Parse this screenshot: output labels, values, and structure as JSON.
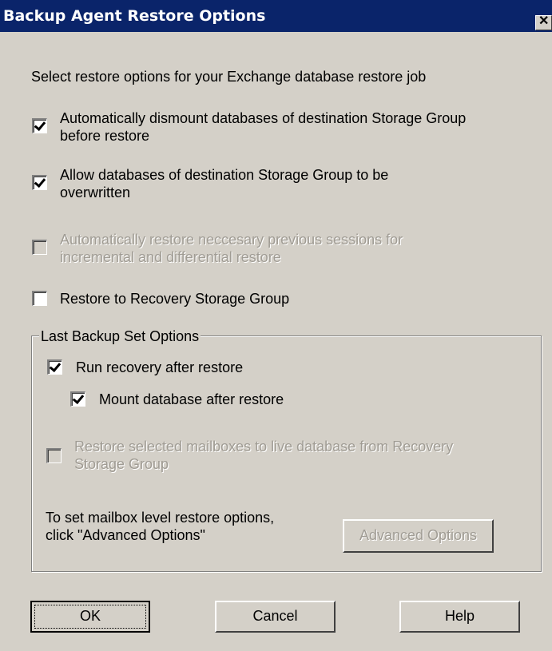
{
  "window": {
    "title": "Backup Agent Restore Options",
    "close_glyph": "✕"
  },
  "prompt": "Select  restore options for your Exchange database restore job",
  "options": [
    {
      "line1": "Automatically dismount databases of destination Storage Group",
      "line2": "before restore",
      "checked": true,
      "enabled": true
    },
    {
      "line1": "Allow databases of destination Storage Group to be",
      "line2": "overwritten",
      "checked": true,
      "enabled": true
    },
    {
      "line1": "Automatically restore neccesary  previous sessions for",
      "line2": "incremental and  differential  restore",
      "checked": false,
      "enabled": false
    },
    {
      "line1": "Restore to Recovery Storage Group",
      "line2": "",
      "checked": false,
      "enabled": true
    }
  ],
  "group": {
    "legend": "Last Backup Set Options",
    "run_recovery": {
      "label": "Run recovery after restore",
      "checked": true
    },
    "mount_db": {
      "label": "Mount database after restore",
      "checked": true
    },
    "restore_mailboxes": {
      "line1": "Restore selected mailboxes to live database from Recovery",
      "line2": "Storage Group",
      "checked": false,
      "enabled": false
    },
    "info_line1": "To set mailbox level restore options,",
    "info_line2": "click \"Advanced Options\"",
    "advanced_button": "Advanced Options"
  },
  "buttons": {
    "ok": "OK",
    "cancel": "Cancel",
    "help": "Help"
  },
  "colors": {
    "titlebar": "#0a246a",
    "face": "#d4d0c8",
    "disabled_text": "#a09c94"
  }
}
